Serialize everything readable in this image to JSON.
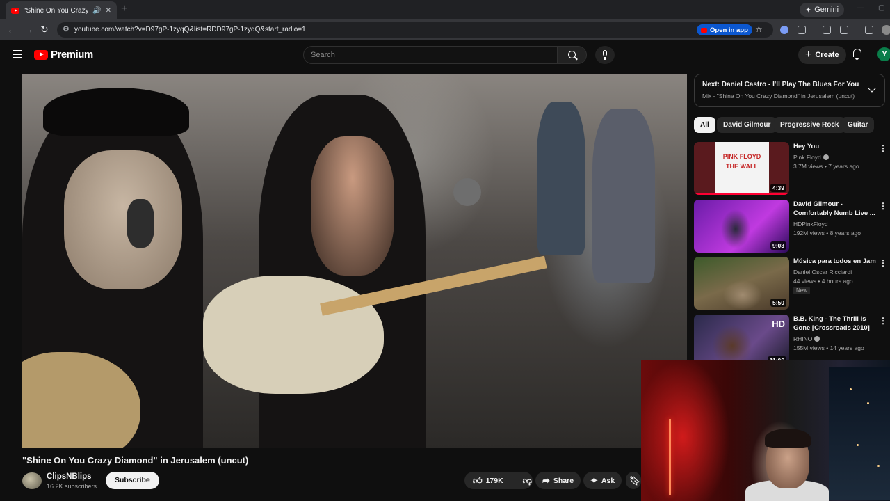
{
  "browser": {
    "tab_title": "\"Shine On You Crazy Diamond\" in Jerusalem (uncut)",
    "url": "youtube.com/watch?v=D97gP-1zyqQ&list=RDD97gP-1zyqQ&start_radio=1",
    "open_in_app": "Open in app",
    "gemini": "Gemini"
  },
  "header": {
    "logo": "Premium",
    "search_placeholder": "Search",
    "create_label": "Create",
    "avatar_letter": "Y"
  },
  "video": {
    "title": "\"Shine On You Crazy Diamond\" in Jerusalem (uncut)",
    "channel": "ClipsNBlips",
    "subscribers": "16.2K subscribers",
    "subscribe_label": "Subscribe",
    "likes": "179K",
    "share_label": "Share",
    "ask_label": "Ask"
  },
  "next": {
    "title": "Next: Daniel Castro - I'll Play The Blues For You",
    "subtitle": "Mix - \"Shine On You Crazy Diamond\" in Jerusalem (uncut)"
  },
  "chips": [
    "All",
    "David Gilmour",
    "Progressive Rock",
    "Guitar"
  ],
  "recommendations": [
    {
      "title": "Hey You",
      "channel": "Pink Floyd",
      "meta": "3.7M views • 7 years ago",
      "duration": "4:39",
      "badge": ""
    },
    {
      "title": "David Gilmour - Comfortably Numb  Live ...",
      "channel": "HDPinkFloyd",
      "meta": "192M views • 8 years ago",
      "duration": "9:03",
      "badge": ""
    },
    {
      "title": "Música para todos en Jam",
      "channel": "Daniel Oscar Ricciardi",
      "meta": "44 views • 4 hours ago",
      "duration": "5:50",
      "badge": "New"
    },
    {
      "title": "B.B. King - The Thrill Is Gone [Crossroads 2010] ...",
      "channel": "RHINO",
      "meta": "155M views • 14 years ago",
      "duration": "11:06",
      "badge": ""
    }
  ],
  "thumb_text": {
    "wall": "PINK FLOYD THE WALL",
    "hd": "HD"
  },
  "colors": {
    "background": "#0f0f0f",
    "youtube_red": "#ff0000",
    "chip_active": "#f1f1f1",
    "open_in_app": "#0b57d0"
  }
}
